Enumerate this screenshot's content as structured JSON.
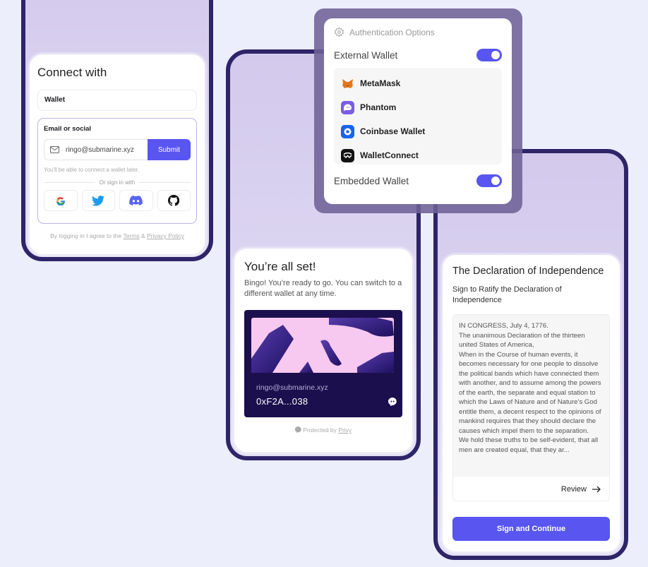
{
  "connect": {
    "title": "Connect with",
    "wallet_label": "Wallet",
    "email_label": "Email or social",
    "email_value": "ringo@submarine.xyz",
    "submit": "Submit",
    "hint": "You'll be able to connect a wallet later.",
    "or_text": "Or sign in with",
    "socials": [
      "google-icon",
      "twitter-icon",
      "discord-icon",
      "github-icon"
    ],
    "terms_prefix": "By logging in I agree to the ",
    "terms_link": "Terms",
    "terms_amp": " & ",
    "privacy_link": "Privacy Policy"
  },
  "success": {
    "title": "You’re all set!",
    "subtitle": "Bingo! You’re ready to go. You can switch to a different wallet at any time.",
    "email": "ringo@submarine.xyz",
    "address": "0xF2A...038",
    "protected_prefix": "Protected by ",
    "protected_link": "Privy"
  },
  "auth": {
    "title": "Authentication Options",
    "external": {
      "label": "External Wallet",
      "enabled": true
    },
    "wallets": [
      {
        "name": "MetaMask",
        "icon": "metamask-icon"
      },
      {
        "name": "Phantom",
        "icon": "phantom-icon"
      },
      {
        "name": "Coinbase Wallet",
        "icon": "coinbase-icon"
      },
      {
        "name": "WalletConnect",
        "icon": "walletconnect-icon"
      }
    ],
    "embedded": {
      "label": "Embedded Wallet",
      "enabled": true
    }
  },
  "sign": {
    "title": "The Declaration of Independence",
    "subtitle": "Sign to Ratify the Declaration of Independence",
    "document": "IN CONGRESS, July 4, 1776.\nThe unanimous Declaration of the thirteen united States of America,\nWhen in the Course of human events, it becomes necessary for one people to dissolve the political bands which have connected them with another, and to assume among the powers of the earth, the separate and equal station to which the Laws of Nature and of Nature's God entitle them, a decent respect to the opinions of mankind requires that they should declare the causes which impel them to the separation.\nWe hold these truths to be self-evident, that all men are created equal, that they ar...",
    "review": "Review",
    "button": "Sign and Continue"
  },
  "colors": {
    "accent": "#5855f0",
    "frame": "#2e2468",
    "wallet_card": "#1b0f4d"
  }
}
